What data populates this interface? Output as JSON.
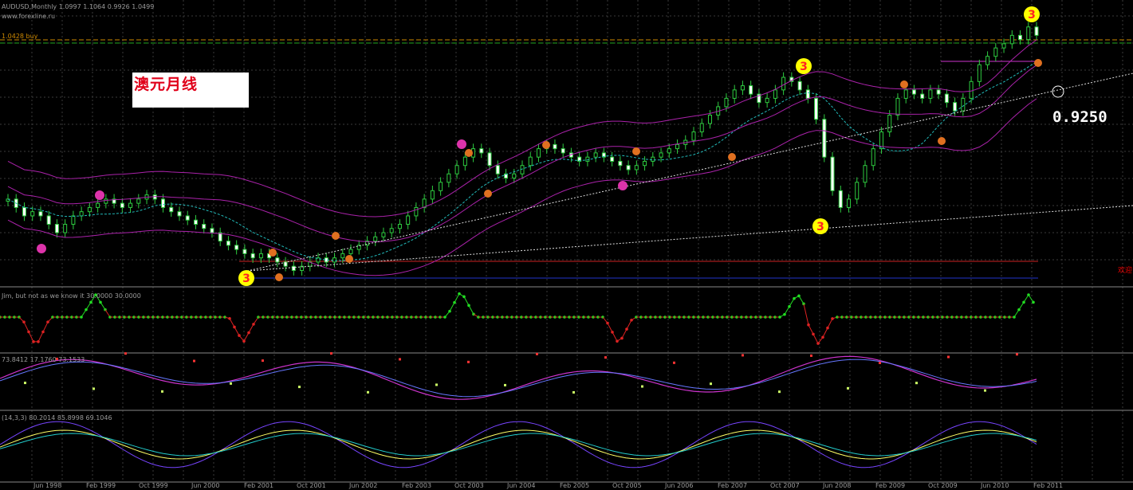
{
  "chart_data": [
    {
      "type": "candlestick",
      "title": "AUDUSD,Monthly 1.0997 1.1064 0.9926 1.0499",
      "source_text": "www.forexline.ru",
      "level_label": "1.0428 buy",
      "annotation": "澳元月线",
      "price_label": "0.9250",
      "right_text": "欢迎",
      "x_labels": [
        "Jun 1998",
        "Feb 1999",
        "Oct 1999",
        "Jun 2000",
        "Feb 2001",
        "Oct 2001",
        "Jun 2002",
        "Feb 2003",
        "Oct 2003",
        "Jun 2004",
        "Feb 2005",
        "Oct 2005",
        "Jun 2006",
        "Feb 2007",
        "Oct 2007",
        "Jun 2008",
        "Feb 2009",
        "Oct 2009",
        "Jun 2010",
        "Feb 2011"
      ],
      "series_close": [
        0.66,
        0.64,
        0.62,
        0.63,
        0.62,
        0.6,
        0.58,
        0.6,
        0.62,
        0.63,
        0.64,
        0.65,
        0.66,
        0.65,
        0.64,
        0.65,
        0.66,
        0.67,
        0.66,
        0.64,
        0.63,
        0.62,
        0.61,
        0.6,
        0.59,
        0.58,
        0.56,
        0.55,
        0.54,
        0.53,
        0.52,
        0.53,
        0.52,
        0.51,
        0.5,
        0.49,
        0.5,
        0.51,
        0.52,
        0.51,
        0.52,
        0.53,
        0.54,
        0.55,
        0.56,
        0.57,
        0.58,
        0.59,
        0.6,
        0.62,
        0.64,
        0.66,
        0.68,
        0.7,
        0.72,
        0.74,
        0.76,
        0.78,
        0.77,
        0.74,
        0.72,
        0.71,
        0.72,
        0.74,
        0.76,
        0.78,
        0.79,
        0.78,
        0.77,
        0.76,
        0.75,
        0.76,
        0.77,
        0.76,
        0.75,
        0.74,
        0.73,
        0.74,
        0.75,
        0.76,
        0.77,
        0.78,
        0.79,
        0.8,
        0.82,
        0.84,
        0.86,
        0.88,
        0.9,
        0.92,
        0.93,
        0.91,
        0.89,
        0.9,
        0.92,
        0.95,
        0.94,
        0.92,
        0.9,
        0.85,
        0.76,
        0.68,
        0.64,
        0.66,
        0.7,
        0.74,
        0.78,
        0.82,
        0.86,
        0.9,
        0.92,
        0.91,
        0.9,
        0.92,
        0.91,
        0.89,
        0.87,
        0.9,
        0.94,
        0.98,
        1.0,
        1.02,
        1.03,
        1.05,
        1.04,
        1.07,
        1.05
      ],
      "indicator_labels": [
        "Jim, but not as we know it 30.0000 30.0000",
        "73.8412 17.1760 73.1533",
        "(14,3,3) 80.2014 85.8998 69.1046"
      ]
    }
  ]
}
